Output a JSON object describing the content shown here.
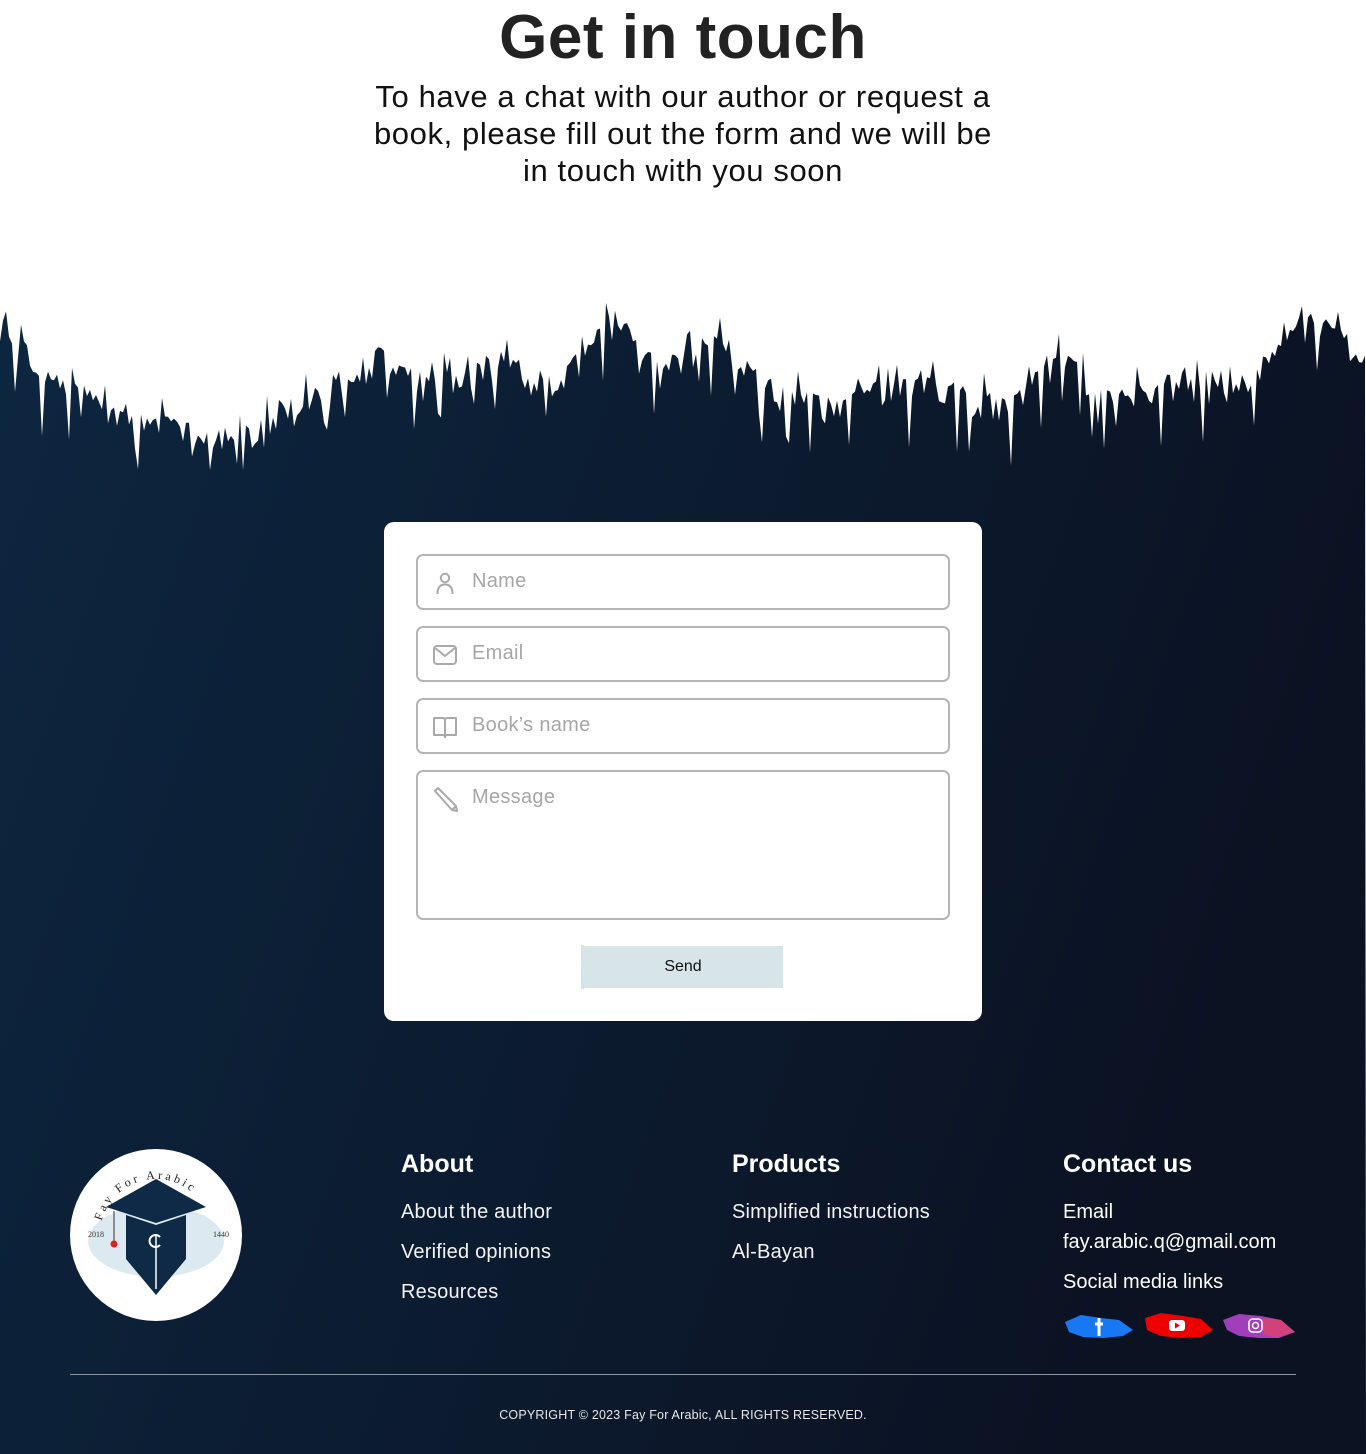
{
  "hero": {
    "title": "Get in touch",
    "subtitle": "To have a chat with our author or request a book, please fill out the form and we will be in touch with you soon"
  },
  "form": {
    "name_placeholder": "Name",
    "email_placeholder": "Email",
    "book_placeholder": "Book’s name",
    "message_placeholder": "Message",
    "send_label": "Send"
  },
  "footer": {
    "logo": {
      "arc_text": "Fay For Arabic",
      "year_left": "2018",
      "year_right": "1440"
    },
    "about": {
      "heading": "About",
      "links": [
        "About the author",
        "Verified opinions",
        "Resources"
      ]
    },
    "products": {
      "heading": "Products",
      "links": [
        "Simplified instructions",
        "Al-Bayan"
      ]
    },
    "contact": {
      "heading": "Contact us",
      "email_label": "Email",
      "email_value": "fay.arabic.q@gmail.com",
      "social_label": "Social media links",
      "social_icons": [
        "facebook-icon",
        "youtube-icon",
        "instagram-icon"
      ]
    },
    "copyright": "COPYRIGHT © 2023 Fay For Arabic, ALL RIGHTS RESERVED."
  },
  "colors": {
    "dark_bg": "#0c2038",
    "card_bg": "#ffffff",
    "button_bg": "#d7e4e8",
    "facebook": "#1877f2",
    "youtube": "#ee0000",
    "instagram": "#a13fbb"
  }
}
